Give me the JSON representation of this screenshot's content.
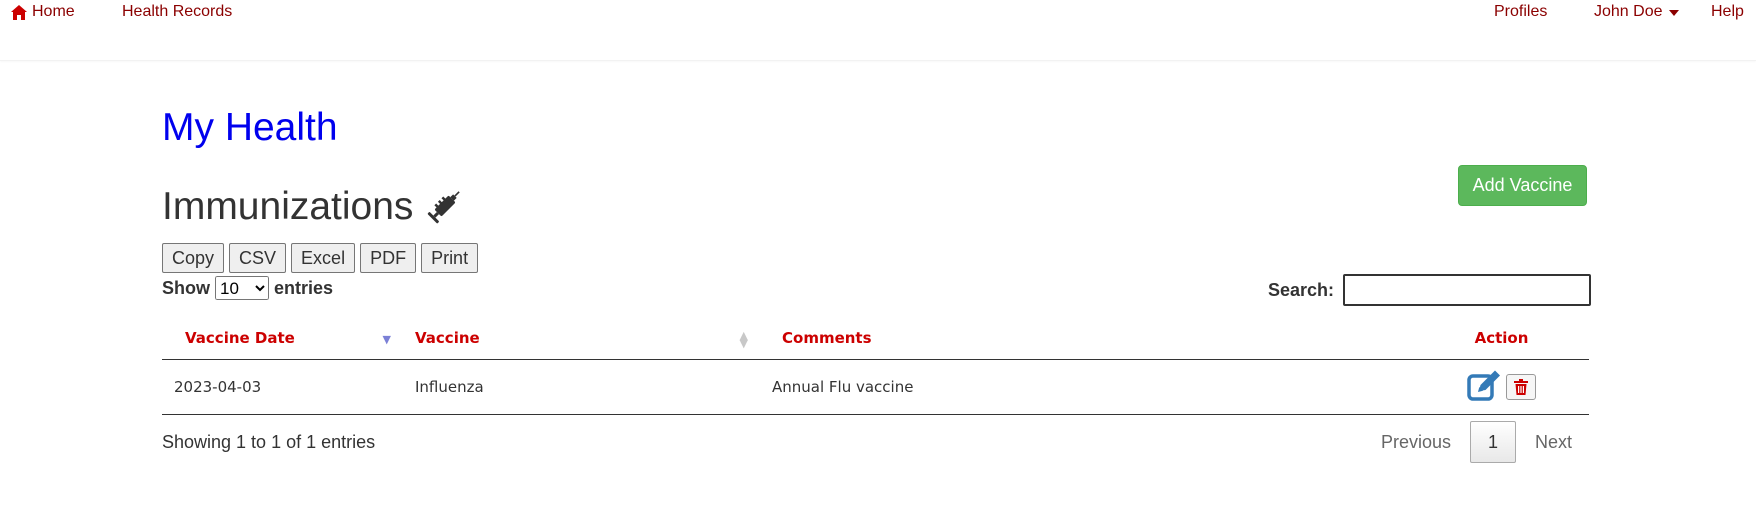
{
  "nav": {
    "home": "Home",
    "health_records": "Health Records",
    "profiles": "Profiles",
    "user": "John Doe",
    "help": "Help"
  },
  "page_title": "My Health",
  "section_title": "Immunizations",
  "add_button": "Add Vaccine",
  "export_buttons": [
    "Copy",
    "CSV",
    "Excel",
    "PDF",
    "Print"
  ],
  "length": {
    "show": "Show",
    "selected": "10",
    "entries": "entries"
  },
  "search": {
    "label": "Search:",
    "value": ""
  },
  "table": {
    "headers": [
      "Vaccine Date",
      "Vaccine",
      "Comments",
      "Action"
    ],
    "rows": [
      {
        "date": "2023-04-03",
        "vaccine": "Influenza",
        "comments": "Annual Flu vaccine"
      }
    ]
  },
  "info": "Showing 1 to 1 of 1 entries",
  "pagination": {
    "previous": "Previous",
    "current": "1",
    "next": "Next"
  },
  "colors": {
    "nav_link": "#8b0000",
    "page_title": "#0000ee",
    "table_header": "#cc0000",
    "add_button": "#5cb85c",
    "edit_icon": "#337ab7",
    "delete_icon": "#cc0000"
  }
}
